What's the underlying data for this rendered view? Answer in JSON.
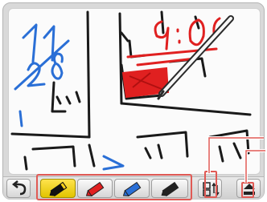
{
  "canvas": {
    "handwriting": {
      "date_line1": "11",
      "date_line2": "28",
      "time": "9:00"
    },
    "ink_colors": {
      "black": "#1a1a1a",
      "red": "#e02020",
      "blue": "#2a6fd6"
    }
  },
  "toolbar": {
    "undo": {
      "icon": "undo-arrow-icon"
    },
    "pens": [
      {
        "icon": "black-pen-icon",
        "color": "#111111",
        "selected": true
      },
      {
        "icon": "red-pen-icon",
        "color": "#e02020",
        "selected": false
      },
      {
        "icon": "blue-pen-icon",
        "color": "#2a6fd6",
        "selected": false
      },
      {
        "icon": "eraser-icon",
        "color": "#222222",
        "selected": false
      }
    ],
    "swap_screens": {
      "icon": "swap-screens-icon"
    },
    "scroll": {
      "icon": "scroll-up-icon"
    }
  },
  "highlight_color": "#e05a55"
}
